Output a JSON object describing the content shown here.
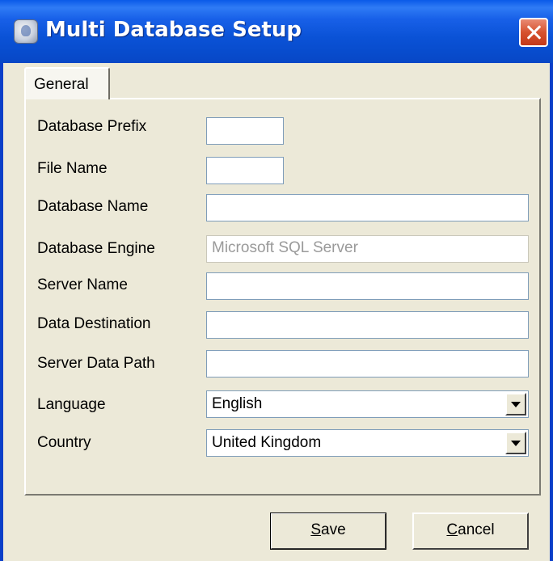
{
  "window": {
    "title": "Multi Database Setup"
  },
  "tabs": [
    {
      "label": "General"
    }
  ],
  "form": {
    "database_prefix": {
      "label": "Database Prefix",
      "value": ""
    },
    "file_name": {
      "label": "File Name",
      "value": ""
    },
    "database_name": {
      "label": "Database Name",
      "value": ""
    },
    "database_engine": {
      "label": "Database Engine",
      "value": "Microsoft SQL Server"
    },
    "server_name": {
      "label": "Server Name",
      "value": ""
    },
    "data_destination": {
      "label": "Data Destination",
      "value": ""
    },
    "server_data_path": {
      "label": "Server Data Path",
      "value": ""
    },
    "language": {
      "label": "Language",
      "value": "English"
    },
    "country": {
      "label": "Country",
      "value": "United Kingdom"
    }
  },
  "buttons": {
    "save": {
      "mnemonic": "S",
      "rest": "ave"
    },
    "cancel": {
      "mnemonic": "C",
      "rest": "ancel"
    }
  },
  "colors": {
    "titlebar": "#0A52D6",
    "close_button": "#D6522F",
    "dialog_bg": "#ECE9D8",
    "disabled_text": "#9A9A9A"
  }
}
